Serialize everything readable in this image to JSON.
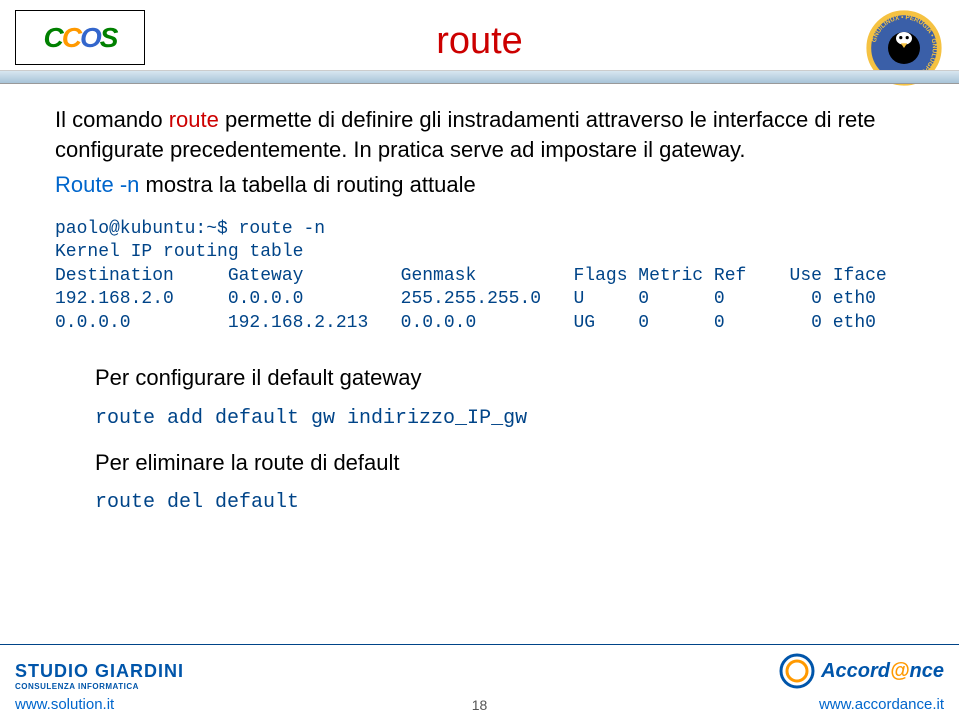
{
  "title": "route",
  "para1_pre": "Il comando ",
  "para1_red": "route",
  "para1_post": " permette di definire gli instradamenti attraverso le interfacce di rete configurate precedentemente. In pratica serve ad impostare il gateway.",
  "para2_blue": "Route -n",
  "para2_post": " mostra la tabella di routing attuale",
  "terminal": "paolo@kubuntu:~$ route -n\nKernel IP routing table\nDestination     Gateway         Genmask         Flags Metric Ref    Use Iface\n192.168.2.0     0.0.0.0         255.255.255.0   U     0      0        0 eth0\n0.0.0.0         192.168.2.213   0.0.0.0         UG    0      0        0 eth0",
  "sub1": "Per configurare il default gateway",
  "cmd1": "route add default gw indirizzo_IP_gw",
  "sub2": "Per eliminare la route di default",
  "cmd2": "route del default",
  "footer": {
    "studio_name": "STUDIO GIARDINI",
    "studio_sub": "CONSULENZA INFORMATICA",
    "left_url": "www.solution.it",
    "right_brand_pre": "Accord",
    "right_brand_at": "@",
    "right_brand_post": "nce",
    "right_url": "www.accordance.it",
    "page": "18"
  }
}
